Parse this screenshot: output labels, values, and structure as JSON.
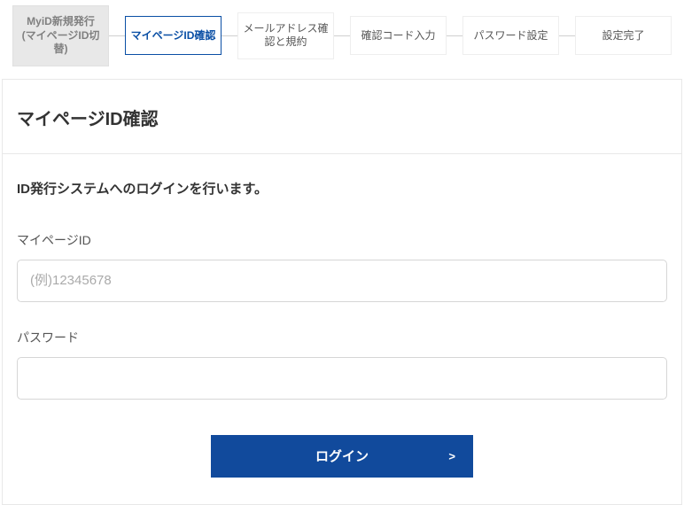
{
  "stepper": {
    "steps": [
      {
        "label": "MyiD新規発行\n(マイページID切替)",
        "state": "done"
      },
      {
        "label": "マイページID確認",
        "state": "active"
      },
      {
        "label": "メールアドレス確認と規約",
        "state": "pending"
      },
      {
        "label": "確認コード入力",
        "state": "pending"
      },
      {
        "label": "パスワード設定",
        "state": "pending"
      },
      {
        "label": "設定完了",
        "state": "pending"
      }
    ]
  },
  "page": {
    "title": "マイページID確認",
    "subheading": "ID発行システムへのログインを行います。"
  },
  "form": {
    "mypage_id_label": "マイページID",
    "mypage_id_placeholder": "(例)12345678",
    "mypage_id_value": "",
    "password_label": "パスワード",
    "password_value": "",
    "submit_label": "ログイン",
    "submit_arrow": ">"
  }
}
